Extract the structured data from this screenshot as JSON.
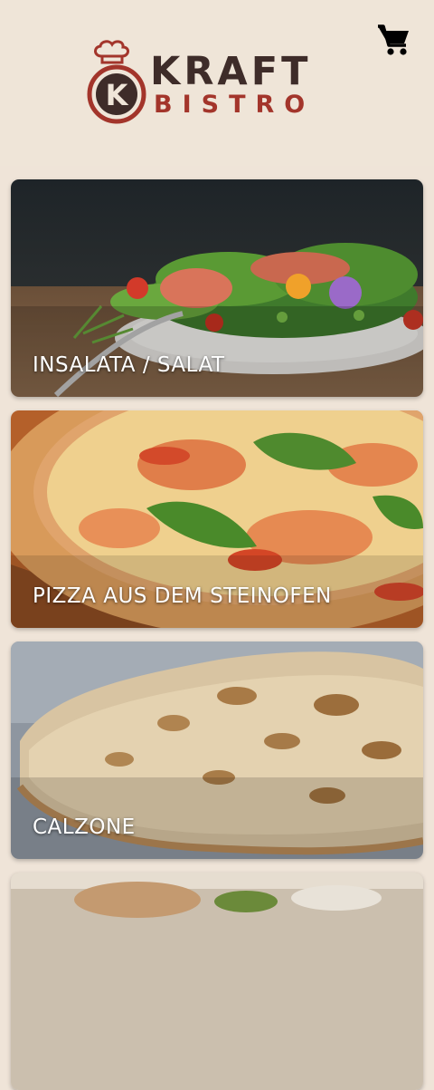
{
  "header": {
    "logo": {
      "word1": "KRAFT",
      "word2": "BISTRO",
      "monogram": "K",
      "color_dark": "#3e2c29",
      "color_red": "#a3352b"
    },
    "cart_icon": "cart-icon"
  },
  "categories": [
    {
      "label": "INSALATA / SALAT",
      "image": "salad-photo"
    },
    {
      "label": "PIZZA AUS DEM STEINOFEN",
      "image": "pizza-photo"
    },
    {
      "label": "CALZONE",
      "image": "calzone-photo"
    },
    {
      "label": "",
      "image": "pasta-photo"
    }
  ],
  "colors": {
    "background": "#efe4d8",
    "label_text": "#ffffff"
  }
}
